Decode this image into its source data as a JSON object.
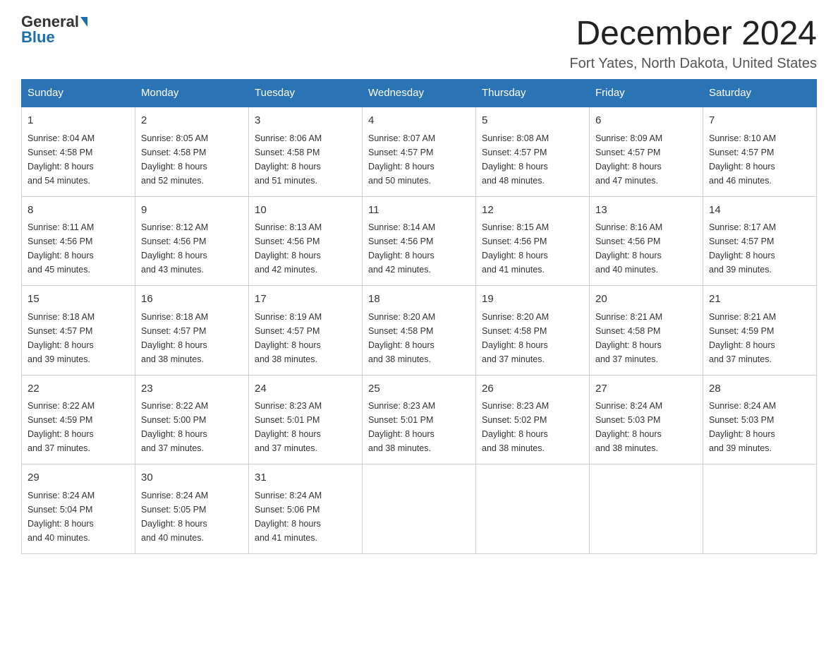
{
  "logo": {
    "general": "General",
    "blue": "Blue"
  },
  "header": {
    "month": "December 2024",
    "location": "Fort Yates, North Dakota, United States"
  },
  "weekdays": [
    "Sunday",
    "Monday",
    "Tuesday",
    "Wednesday",
    "Thursday",
    "Friday",
    "Saturday"
  ],
  "weeks": [
    [
      {
        "day": "1",
        "sunrise": "8:04 AM",
        "sunset": "4:58 PM",
        "daylight": "8 hours and 54 minutes."
      },
      {
        "day": "2",
        "sunrise": "8:05 AM",
        "sunset": "4:58 PM",
        "daylight": "8 hours and 52 minutes."
      },
      {
        "day": "3",
        "sunrise": "8:06 AM",
        "sunset": "4:58 PM",
        "daylight": "8 hours and 51 minutes."
      },
      {
        "day": "4",
        "sunrise": "8:07 AM",
        "sunset": "4:57 PM",
        "daylight": "8 hours and 50 minutes."
      },
      {
        "day": "5",
        "sunrise": "8:08 AM",
        "sunset": "4:57 PM",
        "daylight": "8 hours and 48 minutes."
      },
      {
        "day": "6",
        "sunrise": "8:09 AM",
        "sunset": "4:57 PM",
        "daylight": "8 hours and 47 minutes."
      },
      {
        "day": "7",
        "sunrise": "8:10 AM",
        "sunset": "4:57 PM",
        "daylight": "8 hours and 46 minutes."
      }
    ],
    [
      {
        "day": "8",
        "sunrise": "8:11 AM",
        "sunset": "4:56 PM",
        "daylight": "8 hours and 45 minutes."
      },
      {
        "day": "9",
        "sunrise": "8:12 AM",
        "sunset": "4:56 PM",
        "daylight": "8 hours and 43 minutes."
      },
      {
        "day": "10",
        "sunrise": "8:13 AM",
        "sunset": "4:56 PM",
        "daylight": "8 hours and 42 minutes."
      },
      {
        "day": "11",
        "sunrise": "8:14 AM",
        "sunset": "4:56 PM",
        "daylight": "8 hours and 42 minutes."
      },
      {
        "day": "12",
        "sunrise": "8:15 AM",
        "sunset": "4:56 PM",
        "daylight": "8 hours and 41 minutes."
      },
      {
        "day": "13",
        "sunrise": "8:16 AM",
        "sunset": "4:56 PM",
        "daylight": "8 hours and 40 minutes."
      },
      {
        "day": "14",
        "sunrise": "8:17 AM",
        "sunset": "4:57 PM",
        "daylight": "8 hours and 39 minutes."
      }
    ],
    [
      {
        "day": "15",
        "sunrise": "8:18 AM",
        "sunset": "4:57 PM",
        "daylight": "8 hours and 39 minutes."
      },
      {
        "day": "16",
        "sunrise": "8:18 AM",
        "sunset": "4:57 PM",
        "daylight": "8 hours and 38 minutes."
      },
      {
        "day": "17",
        "sunrise": "8:19 AM",
        "sunset": "4:57 PM",
        "daylight": "8 hours and 38 minutes."
      },
      {
        "day": "18",
        "sunrise": "8:20 AM",
        "sunset": "4:58 PM",
        "daylight": "8 hours and 38 minutes."
      },
      {
        "day": "19",
        "sunrise": "8:20 AM",
        "sunset": "4:58 PM",
        "daylight": "8 hours and 37 minutes."
      },
      {
        "day": "20",
        "sunrise": "8:21 AM",
        "sunset": "4:58 PM",
        "daylight": "8 hours and 37 minutes."
      },
      {
        "day": "21",
        "sunrise": "8:21 AM",
        "sunset": "4:59 PM",
        "daylight": "8 hours and 37 minutes."
      }
    ],
    [
      {
        "day": "22",
        "sunrise": "8:22 AM",
        "sunset": "4:59 PM",
        "daylight": "8 hours and 37 minutes."
      },
      {
        "day": "23",
        "sunrise": "8:22 AM",
        "sunset": "5:00 PM",
        "daylight": "8 hours and 37 minutes."
      },
      {
        "day": "24",
        "sunrise": "8:23 AM",
        "sunset": "5:01 PM",
        "daylight": "8 hours and 37 minutes."
      },
      {
        "day": "25",
        "sunrise": "8:23 AM",
        "sunset": "5:01 PM",
        "daylight": "8 hours and 38 minutes."
      },
      {
        "day": "26",
        "sunrise": "8:23 AM",
        "sunset": "5:02 PM",
        "daylight": "8 hours and 38 minutes."
      },
      {
        "day": "27",
        "sunrise": "8:24 AM",
        "sunset": "5:03 PM",
        "daylight": "8 hours and 38 minutes."
      },
      {
        "day": "28",
        "sunrise": "8:24 AM",
        "sunset": "5:03 PM",
        "daylight": "8 hours and 39 minutes."
      }
    ],
    [
      {
        "day": "29",
        "sunrise": "8:24 AM",
        "sunset": "5:04 PM",
        "daylight": "8 hours and 40 minutes."
      },
      {
        "day": "30",
        "sunrise": "8:24 AM",
        "sunset": "5:05 PM",
        "daylight": "8 hours and 40 minutes."
      },
      {
        "day": "31",
        "sunrise": "8:24 AM",
        "sunset": "5:06 PM",
        "daylight": "8 hours and 41 minutes."
      },
      null,
      null,
      null,
      null
    ]
  ],
  "labels": {
    "sunrise": "Sunrise:",
    "sunset": "Sunset:",
    "daylight": "Daylight:"
  }
}
